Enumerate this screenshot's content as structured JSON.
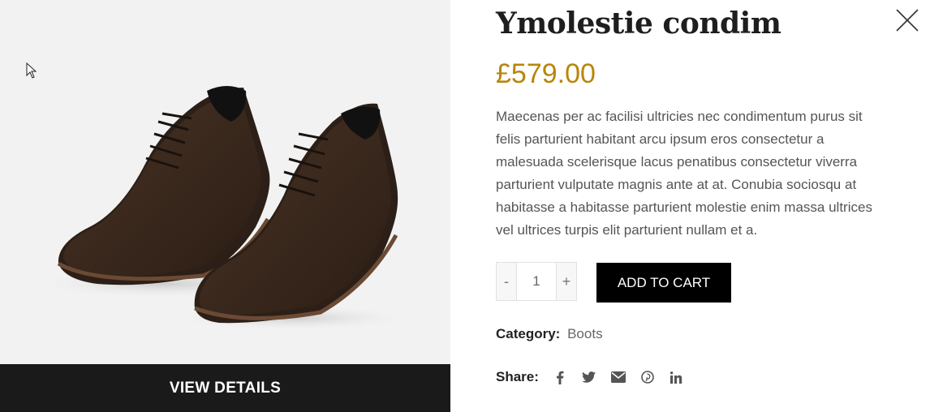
{
  "product": {
    "title": "Ymolestie condim",
    "price": "£579.00",
    "description": "Maecenas per ac facilisi ultricies nec condimentum purus sit felis parturient habitant arcu ipsum eros consectetur a malesuada scelerisque lacus penatibus consectetur viverra parturient vulputate magnis ante at at. Conubia sociosqu at habitasse a habitasse parturient molestie enim massa ultrices vel ultrices turpis elit parturient nullam et a."
  },
  "quantity": {
    "minus": "-",
    "value": "1",
    "plus": "+"
  },
  "actions": {
    "add_to_cart": "ADD TO CART",
    "view_details": "VIEW DETAILS"
  },
  "meta": {
    "category_label": "Category:",
    "category_value": "Boots",
    "share_label": "Share:",
    "share_icons": [
      "facebook-icon",
      "twitter-icon",
      "email-icon",
      "pinterest-icon",
      "linkedin-icon"
    ]
  },
  "colors": {
    "price": "#b8860b",
    "button_bg": "#000000",
    "details_bar": "#1a1a1a",
    "image_bg": "#f2f2f2"
  }
}
